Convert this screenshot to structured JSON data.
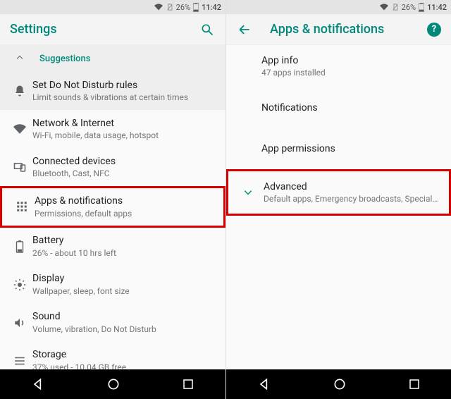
{
  "status": {
    "battery_pct": "26%",
    "time": "11:42"
  },
  "left": {
    "title": "Settings",
    "suggestions_label": "Suggestions",
    "items": [
      {
        "title": "Set Do Not Disturb rules",
        "subtitle": "Limit sounds & vibrations at certain times",
        "icon": "bell"
      },
      {
        "title": "Network & Internet",
        "subtitle": "Wi-Fi, mobile, data usage, hotspot",
        "icon": "wifi"
      },
      {
        "title": "Connected devices",
        "subtitle": "Bluetooth, Cast, NFC",
        "icon": "devices"
      },
      {
        "title": "Apps & notifications",
        "subtitle": "Permissions, default apps",
        "icon": "apps"
      },
      {
        "title": "Battery",
        "subtitle": "26% - about 10 hrs left",
        "icon": "battery"
      },
      {
        "title": "Display",
        "subtitle": "Wallpaper, sleep, font size",
        "icon": "brightness"
      },
      {
        "title": "Sound",
        "subtitle": "Volume, vibration, Do Not Disturb",
        "icon": "sound"
      },
      {
        "title": "Storage",
        "subtitle": "37% used - 10.04 GB free",
        "icon": "storage"
      }
    ]
  },
  "right": {
    "title": "Apps & notifications",
    "items": [
      {
        "title": "App info",
        "subtitle": "47 apps installed"
      },
      {
        "title": "Notifications",
        "subtitle": ""
      },
      {
        "title": "App permissions",
        "subtitle": ""
      },
      {
        "title": "Advanced",
        "subtitle": "Default apps, Emergency broadcasts, Special app .."
      }
    ]
  }
}
